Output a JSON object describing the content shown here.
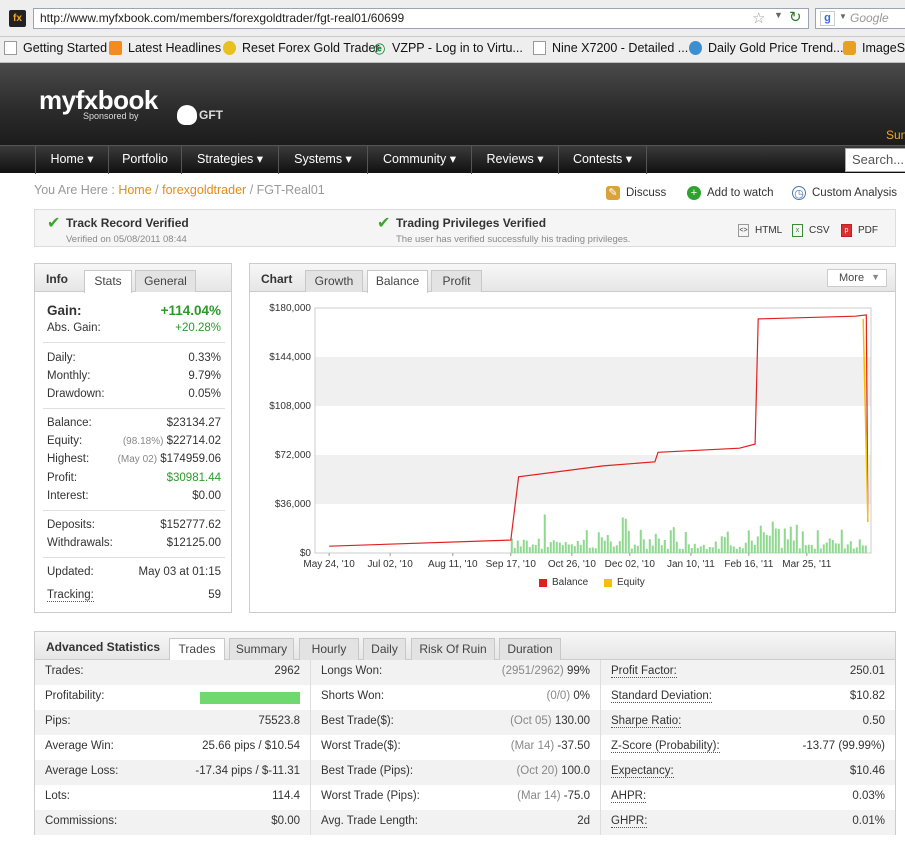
{
  "browser": {
    "url": "http://www.myfxbook.com/members/forexgoldtrader/fgt-real01/60699",
    "search_placeholder": "Google",
    "bookmarks": [
      "Getting Started",
      "Latest Headlines",
      "Reset Forex Gold Trader",
      "VZPP - Log in to Virtu...",
      "Nine X7200 - Detailed ...",
      "Daily Gold Price Trend...",
      "ImageS"
    ]
  },
  "site": {
    "logo": "myfxbook",
    "sponsor": "Sponsored by",
    "sponsor_brand": "GFT",
    "corner_text": "Sun",
    "nav": [
      "Home ▾",
      "Portfolio",
      "Strategies ▾",
      "Systems ▾",
      "Community ▾",
      "Reviews ▾",
      "Contests ▾"
    ],
    "search_placeholder": "Search..."
  },
  "breadcrumb": {
    "prefix": "You Are Here :",
    "home": "Home",
    "user": "forexgoldtrader",
    "page": "FGT-Real01",
    "sep": "/"
  },
  "actions": {
    "discuss": "Discuss",
    "watch": "Add to watch",
    "analysis": "Custom Analysis"
  },
  "verify": {
    "track_title": "Track Record Verified",
    "track_sub": "Verified on 05/08/2011 08:44",
    "trade_title": "Trading Privileges Verified",
    "trade_sub": "The user has verified successfully his trading privileges.",
    "exports": [
      "HTML",
      "CSV",
      "PDF"
    ]
  },
  "info": {
    "title": "Info",
    "tabs": [
      "Stats",
      "General"
    ],
    "gain_label": "Gain:",
    "gain": "+114.04%",
    "abs_label": "Abs. Gain:",
    "abs": "+20.28%",
    "daily_label": "Daily:",
    "daily": "0.33%",
    "monthly_label": "Monthly:",
    "monthly": "9.79%",
    "drawdown_label": "Drawdown:",
    "drawdown": "0.05%",
    "balance_label": "Balance:",
    "balance": "$23134.27",
    "equity_label": "Equity:",
    "equity_pct": "(98.18%)",
    "equity": "$22714.02",
    "highest_label": "Highest:",
    "highest_date": "(May 02)",
    "highest": "$174959.06",
    "profit_label": "Profit:",
    "profit": "$30981.44",
    "interest_label": "Interest:",
    "interest": "$0.00",
    "deposits_label": "Deposits:",
    "deposits": "$152777.62",
    "withdrawals_label": "Withdrawals:",
    "withdrawals": "$12125.00",
    "updated_label": "Updated:",
    "updated": "May 03 at 01:15",
    "tracking_label": "Tracking:",
    "tracking": "59"
  },
  "chart": {
    "title": "Chart",
    "tabs": [
      "Growth",
      "Balance",
      "Profit"
    ],
    "more": "More",
    "colors": {
      "balance": "#e02020",
      "equity": "#f5c000",
      "volume": "#8fd88f"
    }
  },
  "chart_data": {
    "type": "line",
    "x_tick_labels": [
      "May 24, '10",
      "Jul 02, '10",
      "Aug 11, '10",
      "Sep 17, '10",
      "Oct 26, '10",
      "Dec 02, '10",
      "Jan 10, '11",
      "Feb 16, '11",
      "Mar 25, '11"
    ],
    "y_tick_labels": [
      "$180,000",
      "$144,000",
      "$108,000",
      "$72,000",
      "$36,000",
      "$0"
    ],
    "ylim": [
      0,
      180000
    ],
    "grid": true,
    "legend_position": "bottom",
    "series": [
      {
        "name": "Balance",
        "points": [
          [
            "May 24, '10",
            5000
          ],
          [
            "Sep 17, '10",
            9500
          ],
          [
            "Sep 22, '10",
            56000
          ],
          [
            "Nov 15, '10",
            64000
          ],
          [
            "Dec 18, '10",
            67000
          ],
          [
            "Dec 20, '10",
            74000
          ],
          [
            "Feb 10, '11",
            77000
          ],
          [
            "Feb 20, '11",
            80000
          ],
          [
            "Feb 22, '11",
            172000
          ],
          [
            "Apr 25, '11",
            174000
          ],
          [
            "May 02, '11",
            174959
          ],
          [
            "May 03, '11",
            23134
          ]
        ]
      },
      {
        "name": "Equity",
        "points": [
          [
            "Apr 30, '11",
            172000
          ],
          [
            "May 03, '11",
            22714
          ]
        ]
      }
    ],
    "volume_bars_start": "Sep 17, '10"
  },
  "advanced": {
    "title": "Advanced Statistics",
    "tabs": [
      "Trades",
      "Summary",
      "Hourly",
      "Daily",
      "Risk Of Ruin",
      "Duration"
    ],
    "col1": [
      {
        "label": "Trades:",
        "value": "2962"
      },
      {
        "label": "Profitability:",
        "value": "",
        "bar": 1.0
      },
      {
        "label": "Pips:",
        "value": "75523.8"
      },
      {
        "label": "Average Win:",
        "value": "25.66 pips / $10.54"
      },
      {
        "label": "Average Loss:",
        "value": "-17.34 pips / $-11.31"
      },
      {
        "label": "Lots:",
        "value": "114.4"
      },
      {
        "label": "Commissions:",
        "value": "$0.00"
      }
    ],
    "col2": [
      {
        "label": "Longs Won:",
        "note": "(2951/2962)",
        "value": "99%"
      },
      {
        "label": "Shorts Won:",
        "note": "(0/0)",
        "value": "0%"
      },
      {
        "label": "Best Trade($):",
        "note": "(Oct 05)",
        "value": "130.00"
      },
      {
        "label": "Worst Trade($):",
        "note": "(Mar 14)",
        "value": "-37.50"
      },
      {
        "label": "Best Trade (Pips):",
        "note": "(Oct 20)",
        "value": "100.0"
      },
      {
        "label": "Worst Trade (Pips):",
        "note": "(Mar 14)",
        "value": "-75.0"
      },
      {
        "label": "Avg. Trade Length:",
        "note": "",
        "value": "2d"
      }
    ],
    "col3": [
      {
        "label": "Profit Factor:",
        "value": "250.01"
      },
      {
        "label": "Standard Deviation:",
        "value": "$10.82"
      },
      {
        "label": "Sharpe Ratio:",
        "value": "0.50"
      },
      {
        "label": "Z-Score (Probability):",
        "value": "-13.77 (99.99%)"
      },
      {
        "label": "Expectancy:",
        "value": "$10.46"
      },
      {
        "label": "AHPR:",
        "value": "0.03%"
      },
      {
        "label": "GHPR:",
        "value": "0.01%"
      }
    ]
  }
}
